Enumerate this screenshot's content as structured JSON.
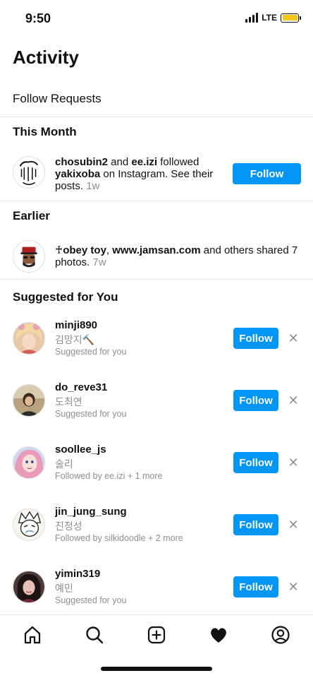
{
  "status": {
    "time": "9:50",
    "network": "LTE",
    "battery_color": "#f5c518"
  },
  "page": {
    "title": "Activity"
  },
  "follow_requests": {
    "label": "Follow Requests"
  },
  "sections": {
    "this_month": "This Month",
    "earlier": "Earlier",
    "suggested": "Suggested for You"
  },
  "notifications": [
    {
      "user1": "chosubin2",
      "joiner": " and ",
      "user2": "ee.izi",
      "text": " followed ",
      "target": "yakixoba",
      "text2": " on Instagram. See their posts.",
      "time": " 1w",
      "button": "Follow"
    },
    {
      "prefix": "♰",
      "user1": "obey toy",
      "sep": ", ",
      "user2": "www.jamsan.com",
      "text": " and others shared 7 photos.",
      "time": " 7w"
    }
  ],
  "suggestions": [
    {
      "username": "minji890",
      "fullname": "김망지🔨",
      "meta": "Suggested for you",
      "button": "Follow",
      "dismiss": "✕"
    },
    {
      "username": "do_reve31",
      "fullname": "도최연",
      "meta": "Suggested for you",
      "button": "Follow",
      "dismiss": "✕"
    },
    {
      "username": "soollee_js",
      "fullname": "술리",
      "meta": "Followed by ee.izi + 1 more",
      "button": "Follow",
      "dismiss": "✕"
    },
    {
      "username": "jin_jung_sung",
      "fullname": "진정성",
      "meta": "Followed by silkidoodle + 2 more",
      "button": "Follow",
      "dismiss": "✕"
    },
    {
      "username": "yimin319",
      "fullname": "예민",
      "meta": "Suggested for you",
      "button": "Follow",
      "dismiss": "✕"
    }
  ],
  "tabs": [
    "home-icon",
    "search-icon",
    "new-post-icon",
    "activity-heart-icon",
    "profile-icon"
  ],
  "colors": {
    "accent": "#0095f6",
    "secondary_text": "#8e8e8e"
  }
}
